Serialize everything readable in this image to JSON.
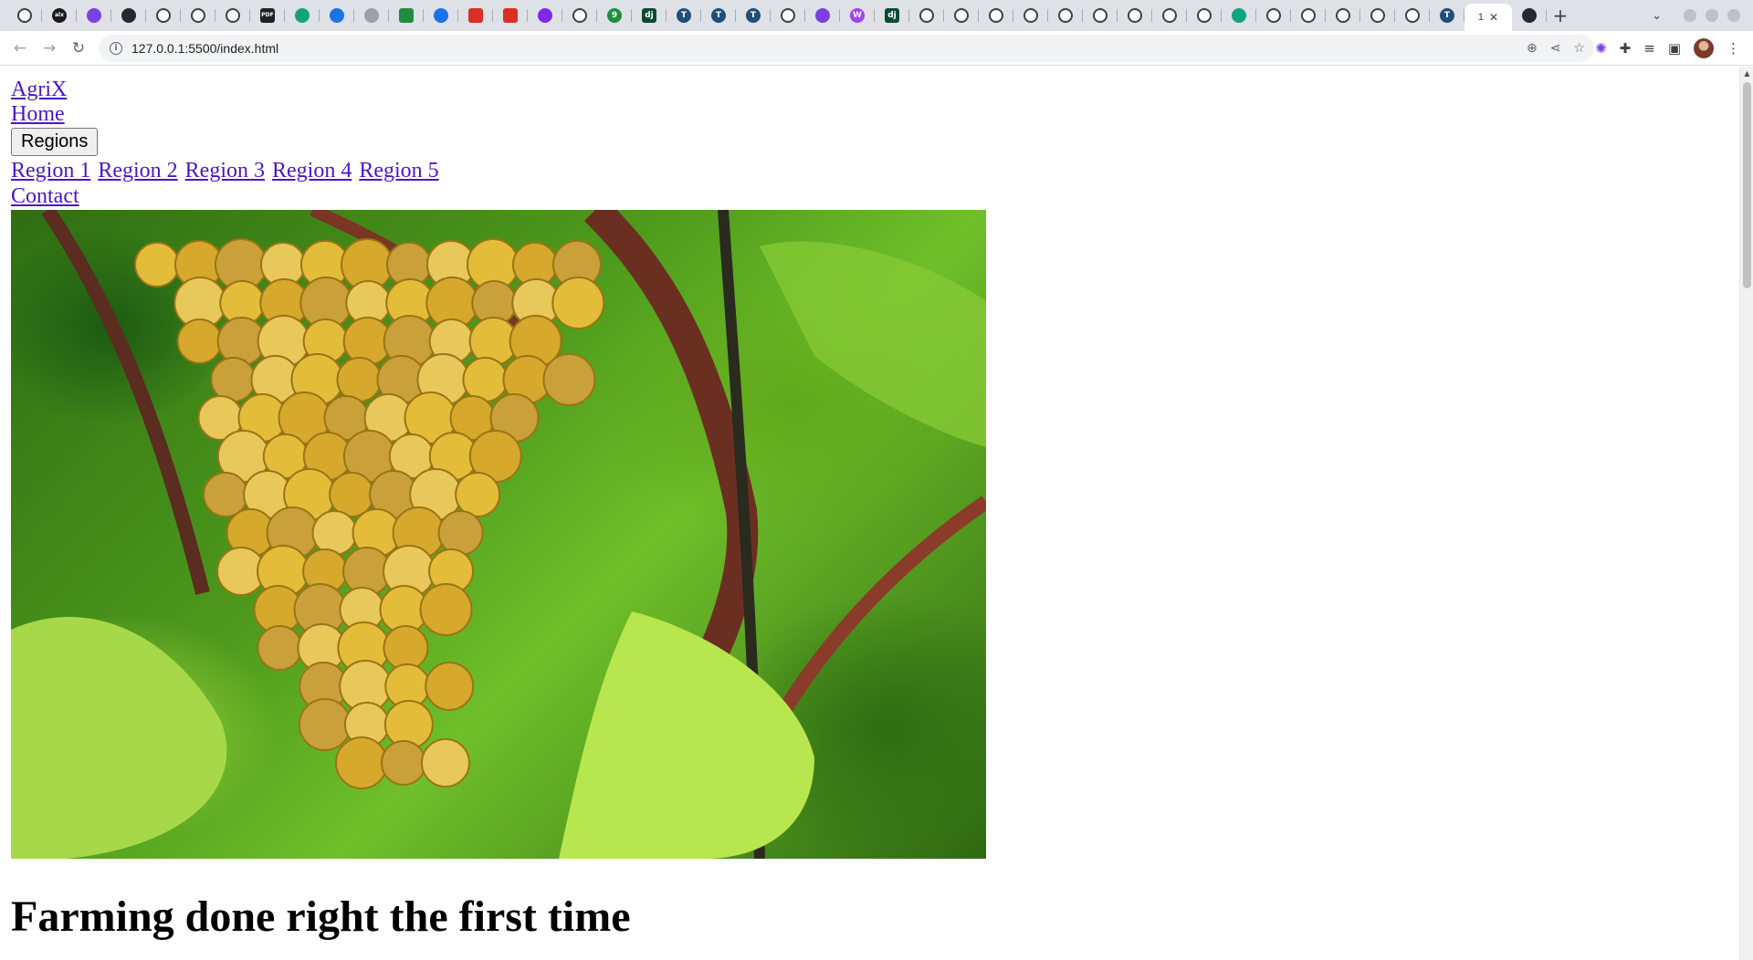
{
  "browser": {
    "url": "127.0.0.1:5500/index.html",
    "tabs": [
      {
        "icon": "globe-icon"
      },
      {
        "icon": "alx-icon",
        "glyph": "alx"
      },
      {
        "icon": "sparkle-icon"
      },
      {
        "icon": "github-icon"
      },
      {
        "icon": "globe-icon"
      },
      {
        "icon": "globe-icon"
      },
      {
        "icon": "globe-icon"
      },
      {
        "icon": "pdf-icon",
        "glyph": "PDF"
      },
      {
        "icon": "chatgpt-icon"
      },
      {
        "icon": "search-icon"
      },
      {
        "icon": "audio-icon"
      },
      {
        "icon": "meet-icon"
      },
      {
        "icon": "search-icon"
      },
      {
        "icon": "acrobat-icon"
      },
      {
        "icon": "acrobat-icon"
      },
      {
        "icon": "canva-icon"
      },
      {
        "icon": "globe-icon"
      },
      {
        "icon": "nine-icon",
        "glyph": "9"
      },
      {
        "icon": "django-icon",
        "glyph": "dj"
      },
      {
        "icon": "t-icon",
        "glyph": "T"
      },
      {
        "icon": "t-icon",
        "glyph": "T"
      },
      {
        "icon": "t-icon",
        "glyph": "T"
      },
      {
        "icon": "globe-icon"
      },
      {
        "icon": "sparkle-icon"
      },
      {
        "icon": "w-icon",
        "glyph": "W"
      },
      {
        "icon": "django-icon",
        "glyph": "dj"
      },
      {
        "icon": "globe-icon"
      },
      {
        "icon": "globe-icon"
      },
      {
        "icon": "globe-icon"
      },
      {
        "icon": "globe-icon"
      },
      {
        "icon": "globe-icon"
      },
      {
        "icon": "globe-icon"
      },
      {
        "icon": "globe-icon"
      },
      {
        "icon": "globe-icon"
      },
      {
        "icon": "globe-icon"
      },
      {
        "icon": "chatgpt-icon"
      },
      {
        "icon": "globe-icon"
      },
      {
        "icon": "globe-icon"
      },
      {
        "icon": "globe-icon"
      },
      {
        "icon": "globe-icon"
      },
      {
        "icon": "globe-icon"
      },
      {
        "icon": "t-icon",
        "glyph": "T"
      }
    ],
    "active_tab_label": "1",
    "colors": {
      "tabstrip": "#dee1e6",
      "link": "#4a16c9"
    }
  },
  "site": {
    "brand": "AgriX",
    "nav_home": "Home",
    "regions_button": "Regions",
    "regions": [
      "Region 1",
      "Region 2",
      "Region 3",
      "Region 4",
      "Region 5"
    ],
    "nav_contact": "Contact",
    "hero_image": "grapes-on-vine-image",
    "headline": "Farming done right the first time"
  }
}
